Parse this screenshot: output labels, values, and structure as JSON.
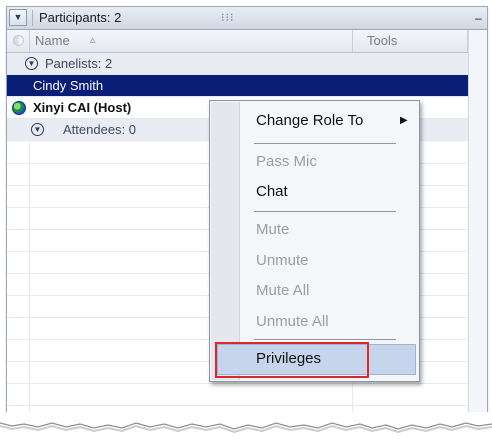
{
  "panel": {
    "title": "Participants: 2",
    "collapse_icon": "triangle-down-icon",
    "grip_icon": "grip-dots-icon",
    "minimize_icon": "minimize-icon"
  },
  "columns": {
    "name": "Name",
    "sort_icon": "sort-indicator-icon",
    "tools": "Tools"
  },
  "rows": {
    "panelists": "Panelists: 2",
    "selected_participant": "Cindy Smith",
    "host": "Xinyi CAI (Host)",
    "attendees": "Attendees: 0"
  },
  "context_menu": {
    "items": [
      {
        "label": "Change Role To",
        "enabled": true,
        "submenu": true
      },
      {
        "label": "Pass Mic",
        "enabled": false
      },
      {
        "label": "Chat",
        "enabled": true
      },
      {
        "label": "Mute",
        "enabled": false
      },
      {
        "label": "Unmute",
        "enabled": false
      },
      {
        "label": "Mute All",
        "enabled": false
      },
      {
        "label": "Unmute All",
        "enabled": false
      },
      {
        "label": "Privileges",
        "enabled": true,
        "highlighted": true,
        "annotated": true
      }
    ]
  },
  "colors": {
    "selection": "#0a1e78",
    "group_row": "#e9edf3",
    "menu_highlight": "#c6d4ec",
    "annotation": "#e0262d"
  }
}
